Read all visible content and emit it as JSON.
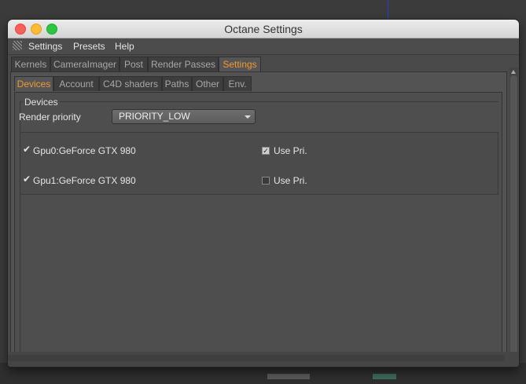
{
  "window": {
    "title": "Octane Settings"
  },
  "menu": [
    "Settings",
    "Presets",
    "Help"
  ],
  "main_tabs": [
    {
      "label": "Kernels",
      "active": false
    },
    {
      "label": "CameraImager",
      "active": false
    },
    {
      "label": "Post",
      "active": false
    },
    {
      "label": "Render Passes",
      "active": false
    },
    {
      "label": "Settings",
      "active": true
    }
  ],
  "sub_tabs": [
    {
      "label": "Devices",
      "active": true
    },
    {
      "label": "Account",
      "active": false
    },
    {
      "label": "C4D shaders",
      "active": false
    },
    {
      "label": "Paths",
      "active": false
    },
    {
      "label": "Other",
      "active": false
    },
    {
      "label": "Env.",
      "active": false
    }
  ],
  "devices": {
    "group_title": "Devices",
    "render_priority_label": "Render priority",
    "render_priority_value": "PRIORITY_LOW",
    "gpus": [
      {
        "name": "Gpu0:GeForce GTX 980",
        "enabled": true,
        "use_pri_label": "Use Pri.",
        "use_pri": true
      },
      {
        "name": "Gpu1:GeForce GTX 980",
        "enabled": true,
        "use_pri_label": "Use Pri.",
        "use_pri": false
      }
    ]
  },
  "colors": {
    "accent": "#f09a2c",
    "panel": "#4e4e4e"
  }
}
